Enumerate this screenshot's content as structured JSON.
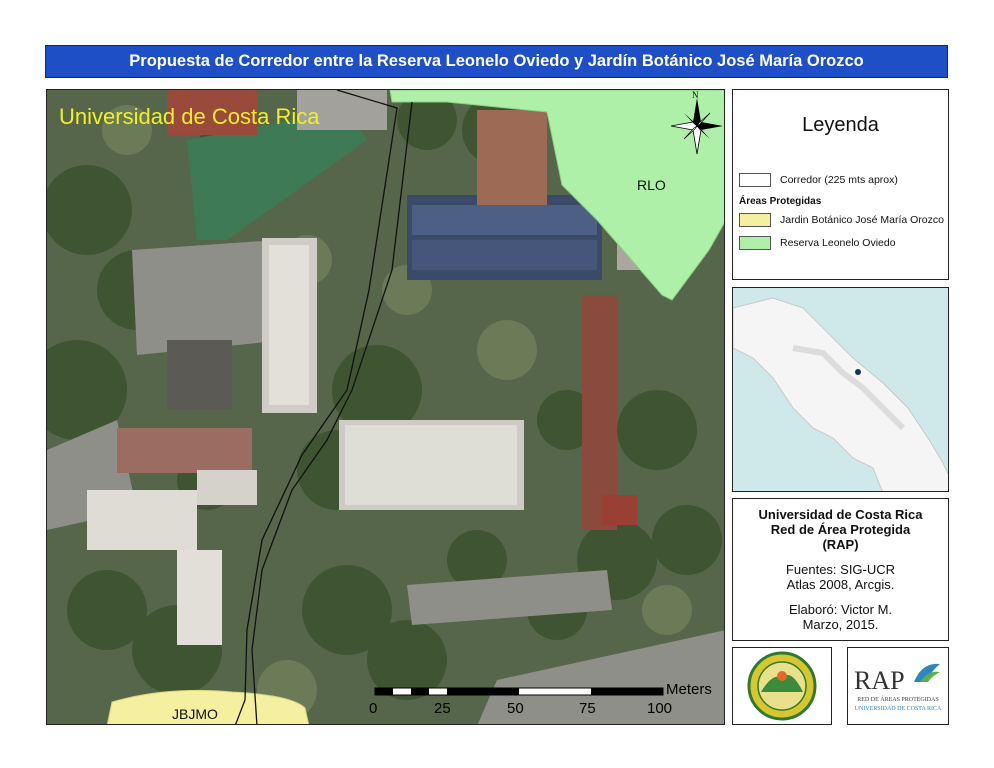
{
  "title": "Propuesta de Corredor entre la Reserva Leonelo Oviedo y Jardín Botánico José María Orozco",
  "map": {
    "campus_label": "Universidad de Costa Rica",
    "rlo_label": "RLO",
    "jbjmo_label": "JBJMO",
    "north_label": "N",
    "colors": {
      "rlo": "#aef0a8",
      "jbjmo": "#f4f0a0",
      "campus_label": "#f2ef2a"
    }
  },
  "scale_bar": {
    "unit": "Meters",
    "ticks": [
      "0",
      "25",
      "50",
      "75",
      "100"
    ]
  },
  "legend": {
    "title": "Leyenda",
    "corridor": "Corredor (225 mts aprox)",
    "protected_heading": "Áreas Protegidas",
    "items": [
      {
        "label": "Jardin Botánico José María Orozco",
        "color": "#f4f0a0"
      },
      {
        "label": "Reserva Leonelo Oviedo",
        "color": "#aef0a8"
      }
    ]
  },
  "credits": {
    "org1": "Universidad de Costa Rica",
    "org2": "Red de Área Protegida",
    "org3": "(RAP)",
    "sources1": "Fuentes: SIG-UCR",
    "sources2": "Atlas 2008, Arcgis.",
    "author1": "Elaboró: Victor M.",
    "author2": "Marzo, 2015."
  },
  "logos": {
    "rap_text": "RAP",
    "rap_sub1": "RED DE ÁREAS PROTEGIDAS",
    "rap_sub2": "UNIVERSIDAD DE COSTA RICA"
  }
}
